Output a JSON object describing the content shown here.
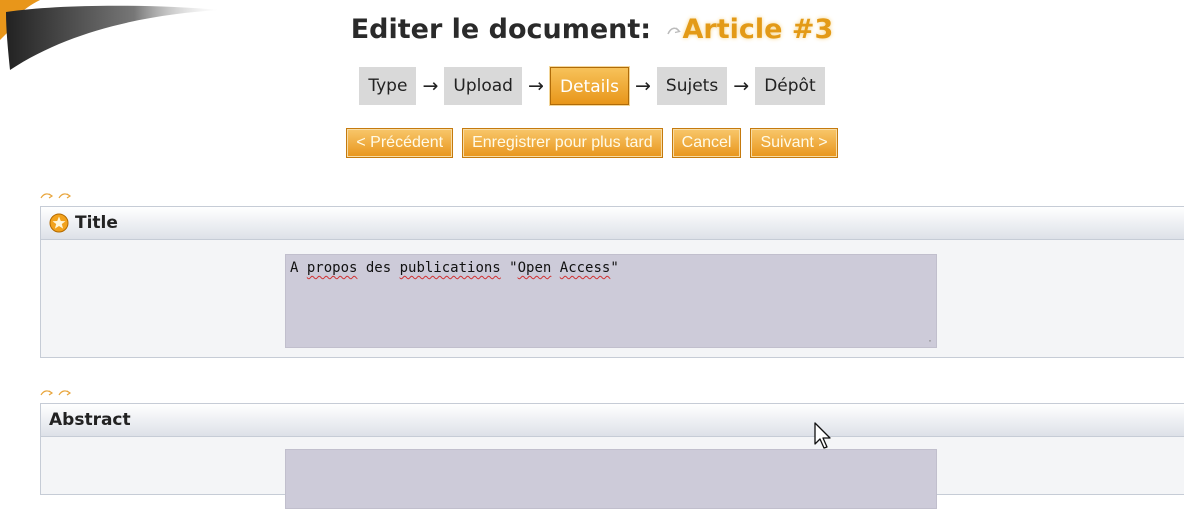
{
  "header": {
    "title_prefix": "Editer le document:",
    "document_name": "Article #3"
  },
  "steps": [
    {
      "label": "Type",
      "current": false
    },
    {
      "label": "Upload",
      "current": false
    },
    {
      "label": "Details",
      "current": true
    },
    {
      "label": "Sujets",
      "current": false
    },
    {
      "label": "Dépôt",
      "current": false
    }
  ],
  "actions": {
    "previous_label": "< Précédent",
    "save_later_label": "Enregistrer pour plus tard",
    "cancel_label": "Cancel",
    "next_label": "Suivant >"
  },
  "fields": {
    "title": {
      "label": "Title",
      "required": true,
      "value_parts": [
        "A ",
        "propos",
        " des ",
        "publications",
        " \"",
        "Open",
        " ",
        "Access",
        "\""
      ]
    },
    "abstract": {
      "label": "Abstract",
      "value": ""
    }
  },
  "colors": {
    "accent_orange": "#e8961a",
    "step_grey": "#d9d9d9",
    "panel_border": "#c6ccd6",
    "textarea_bg": "#cdcbd9"
  }
}
